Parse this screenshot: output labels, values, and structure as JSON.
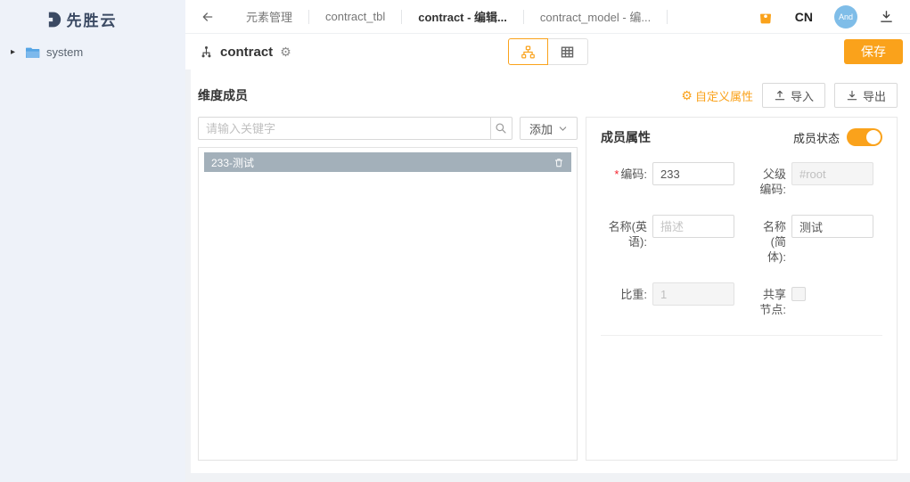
{
  "sidebar": {
    "logo_text": "先胜云",
    "tree_items": [
      {
        "label": "system"
      }
    ]
  },
  "topbar": {
    "tabs": [
      {
        "label": "元素管理",
        "active": false
      },
      {
        "label": "contract_tbl",
        "active": false
      },
      {
        "label": "contract - 编辑...",
        "active": true
      },
      {
        "label": "contract_model - 编...",
        "active": false
      }
    ],
    "language": "CN",
    "avatar_text": "And"
  },
  "toolbar": {
    "title": "contract",
    "save_label": "保存"
  },
  "content": {
    "left_panel": {
      "title": "维度成员",
      "search_placeholder": "请输入关键字",
      "add_label": "添加",
      "items": [
        {
          "label": "233-测试",
          "selected": true
        }
      ]
    },
    "actions": {
      "custom_attr": "自定义属性",
      "import": "导入",
      "export": "导出"
    },
    "right_panel": {
      "title": "成员属性",
      "status_label": "成员状态",
      "status_on": true,
      "fields": {
        "code": {
          "label": "编码:",
          "required": true,
          "value": "233"
        },
        "parent_code": {
          "label": "父级编码:",
          "disabled": true,
          "value": "#root"
        },
        "name_en": {
          "label": "名称(英语):",
          "placeholder": "描述"
        },
        "name_cn": {
          "label": "名称(简体):",
          "value": "测试"
        },
        "weight": {
          "label": "比重:",
          "disabled": true,
          "value": "1"
        },
        "shared_node": {
          "label": "共享节点:",
          "checked": false
        }
      }
    }
  },
  "colors": {
    "accent": "#faa21b",
    "selected_item_bg": "#a3b0ba",
    "avatar_bg": "#7fbde8",
    "folder": "#55a5e5",
    "logo": "#3b4a63",
    "sidebar_bg": "#eef2f9"
  }
}
